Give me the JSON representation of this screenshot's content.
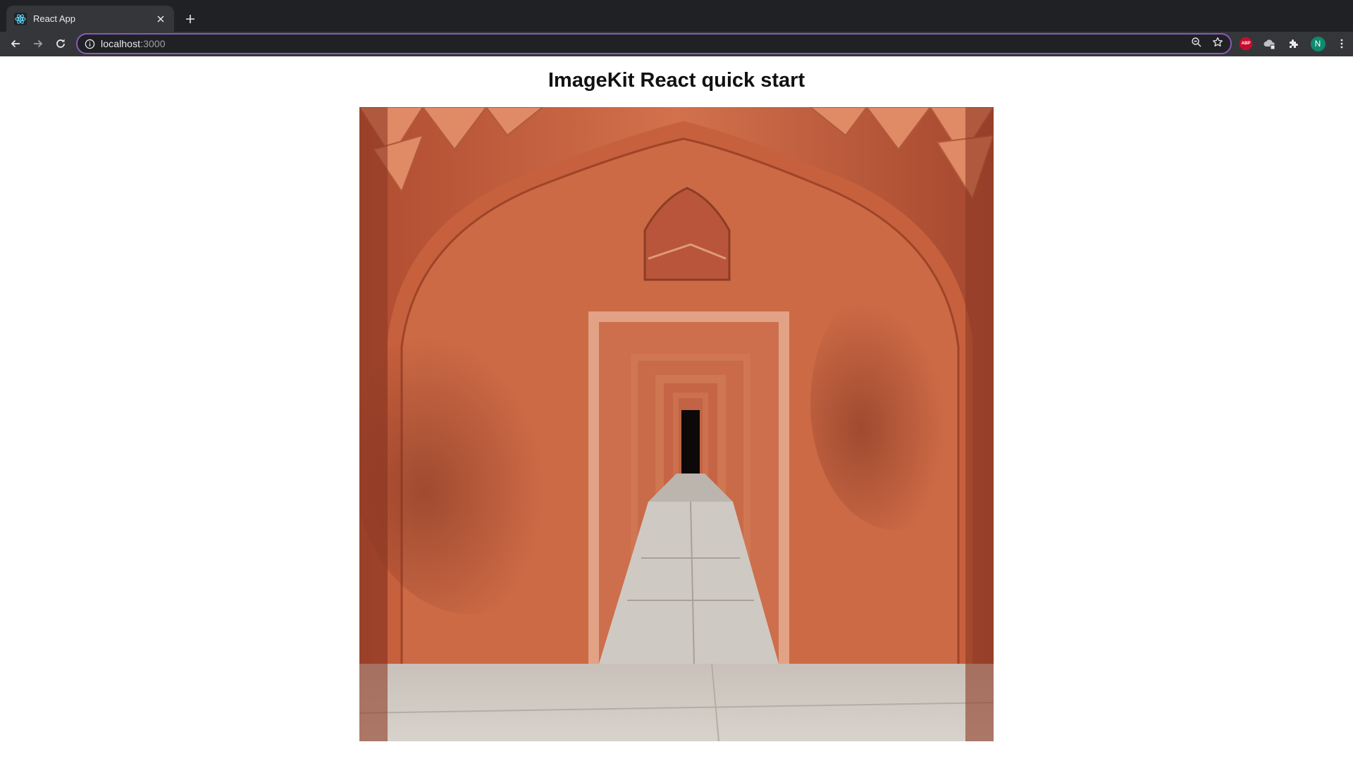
{
  "browser": {
    "tab": {
      "title": "React App",
      "favicon": "react-atom-icon"
    },
    "url": {
      "host": "localhost",
      "port": ":3000"
    },
    "extensions": {
      "abp_label": "ABP"
    },
    "profile_initial": "N"
  },
  "page": {
    "title": "ImageKit React quick start"
  },
  "colors": {
    "chrome_dark": "#202124",
    "chrome_tab": "#35363a",
    "omnibox_focus": "#8a5ab8",
    "avatar": "#0e8a6e",
    "abp": "#c70d2c",
    "sandstone": "#c4603f"
  }
}
